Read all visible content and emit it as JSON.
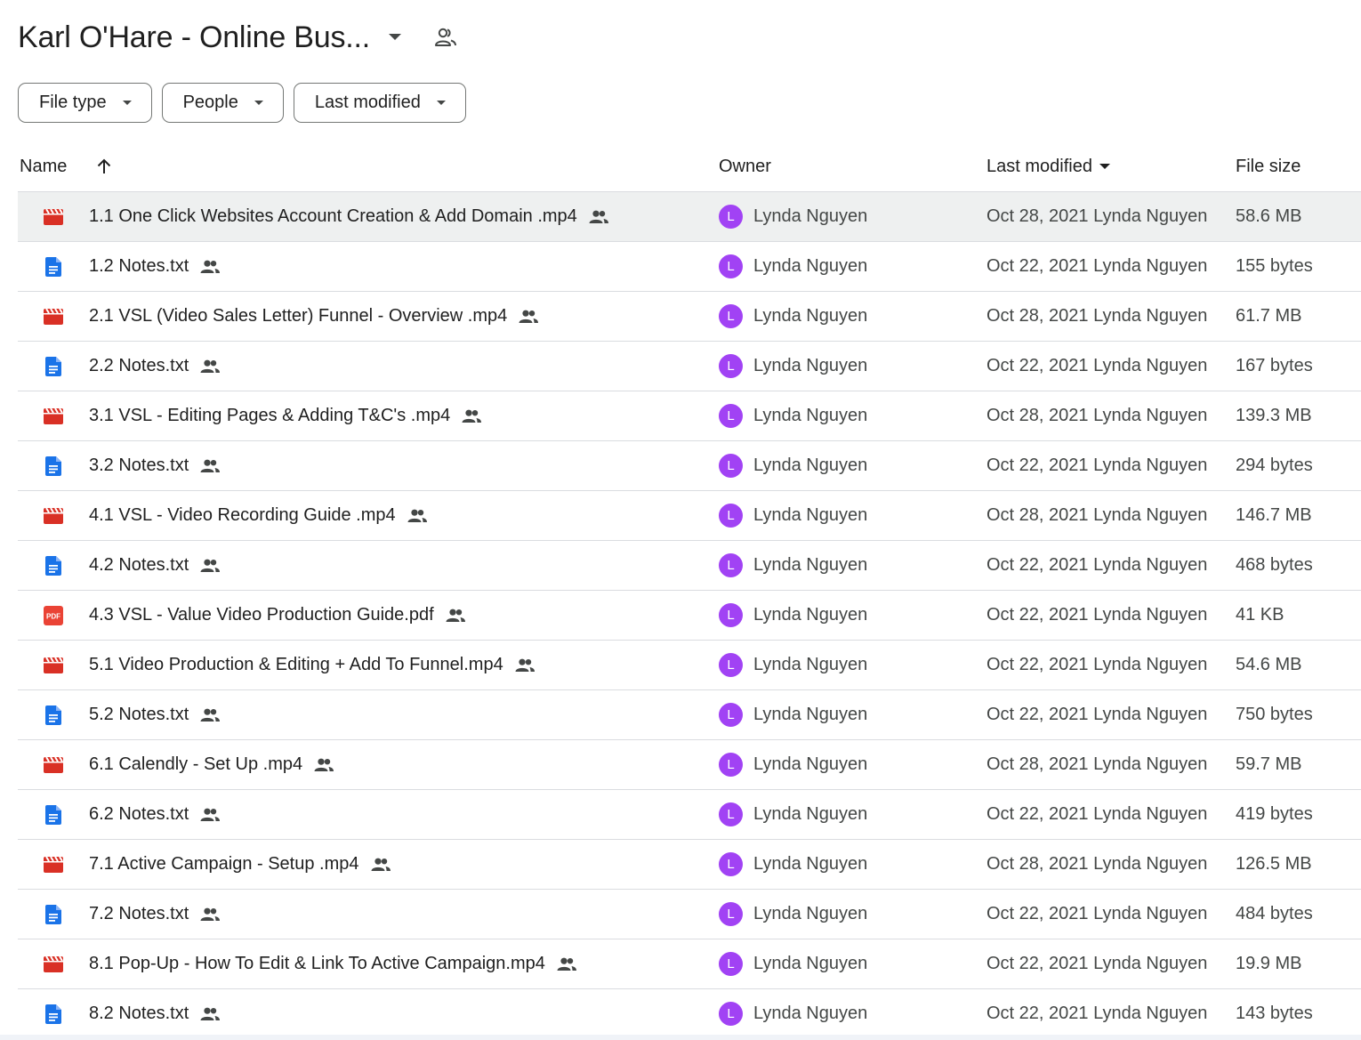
{
  "folder": {
    "title": "Karl O'Hare - Online Bus..."
  },
  "filters": [
    {
      "label": "File type"
    },
    {
      "label": "People"
    },
    {
      "label": "Last modified"
    }
  ],
  "columns": {
    "name": "Name",
    "owner": "Owner",
    "last_modified": "Last modified",
    "file_size": "File size"
  },
  "colors": {
    "video_icon": "#d93025",
    "doc_icon": "#1a73e8",
    "pdf_icon": "#ea4335",
    "avatar": "#a142f4"
  },
  "files": [
    {
      "icon": "video-icon",
      "name": "1.1 One Click Websites Account Creation & Add Domain .mp4",
      "owner": "Lynda Nguyen",
      "avatar": "L",
      "modified": "Oct 28, 2021 Lynda Nguyen",
      "size": "58.6 MB"
    },
    {
      "icon": "doc-icon",
      "name": "1.2 Notes.txt",
      "owner": "Lynda Nguyen",
      "avatar": "L",
      "modified": "Oct 22, 2021 Lynda Nguyen",
      "size": "155 bytes"
    },
    {
      "icon": "video-icon",
      "name": "2.1  VSL (Video Sales Letter) Funnel - Overview .mp4",
      "owner": "Lynda Nguyen",
      "avatar": "L",
      "modified": "Oct 28, 2021 Lynda Nguyen",
      "size": "61.7 MB"
    },
    {
      "icon": "doc-icon",
      "name": "2.2 Notes.txt",
      "owner": "Lynda Nguyen",
      "avatar": "L",
      "modified": "Oct 22, 2021 Lynda Nguyen",
      "size": "167 bytes"
    },
    {
      "icon": "video-icon",
      "name": "3.1  VSL - Editing Pages & Adding T&C's .mp4",
      "owner": "Lynda Nguyen",
      "avatar": "L",
      "modified": "Oct 28, 2021 Lynda Nguyen",
      "size": "139.3 MB"
    },
    {
      "icon": "doc-icon",
      "name": "3.2 Notes.txt",
      "owner": "Lynda Nguyen",
      "avatar": "L",
      "modified": "Oct 22, 2021 Lynda Nguyen",
      "size": "294 bytes"
    },
    {
      "icon": "video-icon",
      "name": "4.1 VSL - Video Recording Guide .mp4",
      "owner": "Lynda Nguyen",
      "avatar": "L",
      "modified": "Oct 28, 2021 Lynda Nguyen",
      "size": "146.7 MB"
    },
    {
      "icon": "doc-icon",
      "name": "4.2 Notes.txt",
      "owner": "Lynda Nguyen",
      "avatar": "L",
      "modified": "Oct 22, 2021 Lynda Nguyen",
      "size": "468 bytes"
    },
    {
      "icon": "pdf-icon",
      "name": "4.3 VSL - Value Video Production Guide.pdf",
      "owner": "Lynda Nguyen",
      "avatar": "L",
      "modified": "Oct 22, 2021 Lynda Nguyen",
      "size": "41 KB"
    },
    {
      "icon": "video-icon",
      "name": "5.1 Video Production & Editing + Add To Funnel.mp4",
      "owner": "Lynda Nguyen",
      "avatar": "L",
      "modified": "Oct 22, 2021 Lynda Nguyen",
      "size": "54.6 MB"
    },
    {
      "icon": "doc-icon",
      "name": "5.2 Notes.txt",
      "owner": "Lynda Nguyen",
      "avatar": "L",
      "modified": "Oct 22, 2021 Lynda Nguyen",
      "size": "750 bytes"
    },
    {
      "icon": "video-icon",
      "name": "6.1 Calendly - Set Up .mp4",
      "owner": "Lynda Nguyen",
      "avatar": "L",
      "modified": "Oct 28, 2021 Lynda Nguyen",
      "size": "59.7 MB"
    },
    {
      "icon": "doc-icon",
      "name": "6.2 Notes.txt",
      "owner": "Lynda Nguyen",
      "avatar": "L",
      "modified": "Oct 22, 2021 Lynda Nguyen",
      "size": "419 bytes"
    },
    {
      "icon": "video-icon",
      "name": "7.1  Active Campaign - Setup .mp4",
      "owner": "Lynda Nguyen",
      "avatar": "L",
      "modified": "Oct 28, 2021 Lynda Nguyen",
      "size": "126.5 MB"
    },
    {
      "icon": "doc-icon",
      "name": "7.2 Notes.txt",
      "owner": "Lynda Nguyen",
      "avatar": "L",
      "modified": "Oct 22, 2021 Lynda Nguyen",
      "size": "484 bytes"
    },
    {
      "icon": "video-icon",
      "name": "8.1 Pop-Up - How To Edit & Link To Active Campaign.mp4",
      "owner": "Lynda Nguyen",
      "avatar": "L",
      "modified": "Oct 22, 2021 Lynda Nguyen",
      "size": "19.9 MB"
    },
    {
      "icon": "doc-icon",
      "name": "8.2 Notes.txt",
      "owner": "Lynda Nguyen",
      "avatar": "L",
      "modified": "Oct 22, 2021 Lynda Nguyen",
      "size": "143 bytes"
    }
  ]
}
